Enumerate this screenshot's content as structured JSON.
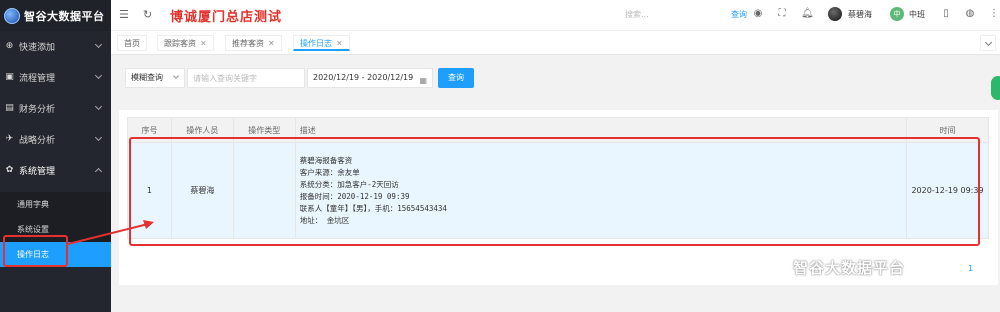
{
  "sidebar": {
    "logo_text": "智谷大数据平台",
    "menu": [
      {
        "label": "快速添加",
        "icon": "plus-icon"
      },
      {
        "label": "流程管理",
        "icon": "flow-icon"
      },
      {
        "label": "财务分析",
        "icon": "finance-icon"
      },
      {
        "label": "战略分析",
        "icon": "strategy-icon"
      },
      {
        "label": "系统管理",
        "icon": "settings-icon"
      }
    ],
    "submenu": [
      "通用字典",
      "系统设置",
      "操作日志"
    ]
  },
  "header": {
    "title": "博诚厦门总店测试",
    "search_placeholder": "搜索...",
    "query_label": "查询",
    "user_name": "蔡碧海",
    "shift_badge": "中",
    "shift_label": "中班"
  },
  "tabs": [
    {
      "label": "首页",
      "closable": false
    },
    {
      "label": "跟踪客资",
      "closable": true
    },
    {
      "label": "推荐客资",
      "closable": true
    },
    {
      "label": "操作日志",
      "closable": true,
      "active": true
    }
  ],
  "toolbar": {
    "match_mode": "模糊查询",
    "keyword_placeholder": "请输入查询关键字",
    "date_range": "2020/12/19 - 2020/12/19",
    "query_button": "查询"
  },
  "table": {
    "headers": [
      "序号",
      "操作人员",
      "操作类型",
      "描述",
      "时间"
    ],
    "rows": [
      {
        "index": "1",
        "operator": "蔡碧海",
        "type": "",
        "description": [
          "蔡碧海报备客资",
          "客户来源：余友单",
          "系统分类：加急客户-2天回访",
          "报备时间：2020-12-19 09:39",
          "联系人【童年】【男】，手机：15654543434",
          "地址： 金坑区"
        ],
        "time": "2020-12-19 09:39"
      }
    ]
  },
  "pager": {
    "page": "1"
  },
  "watermark": {
    "text": "智谷大数据平台"
  },
  "colors": {
    "accent": "#1e9fff",
    "sidebar": "#23262e",
    "highlight": "#e53030",
    "title": "#e3312b"
  }
}
